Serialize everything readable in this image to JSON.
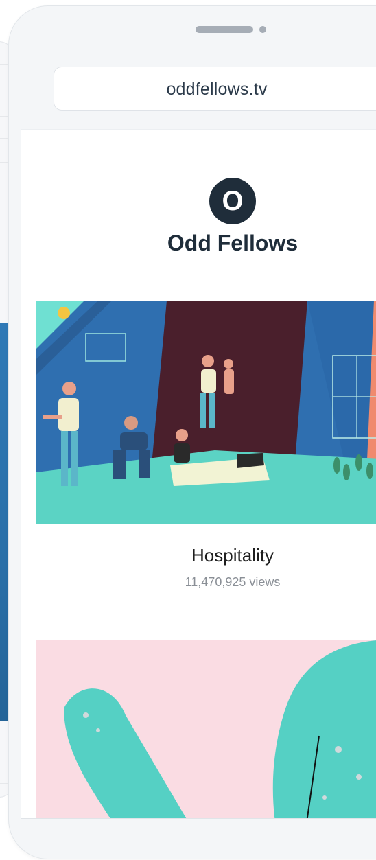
{
  "browser": {
    "url": "oddfellows.tv"
  },
  "site": {
    "logo_letter": "O",
    "name": "Odd Fellows"
  },
  "videos": [
    {
      "title": "Hospitality",
      "views": "11,470,925 views"
    }
  ],
  "colors": {
    "brand_dark": "#1f2d3a",
    "thumb_blue": "#2f6fb0",
    "thumb_maroon": "#4a1f2c",
    "thumb_teal": "#5bd3c4",
    "thumb_pink": "#fadce3"
  }
}
